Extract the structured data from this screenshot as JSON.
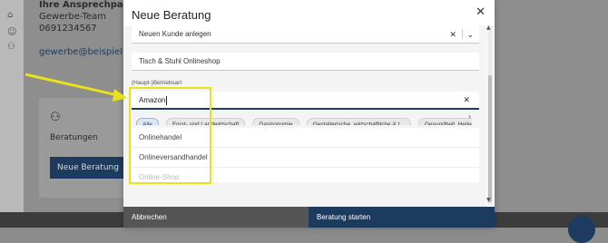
{
  "background": {
    "contact_title": "Ihre Ansprechpartner be",
    "contact_team": "Gewerbe-Team",
    "contact_phone": "0691234567",
    "contact_email": "gewerbe@beispiel.de",
    "card_label": "Beratungen",
    "card_button": "Neue Beratung"
  },
  "modal": {
    "title": "Neue Beratung",
    "customer_field_value": "Neuen Kunde anlegen",
    "shop_field_value": "Tisch & Stuhl Onlineshop",
    "business_type_label": "(Haupt-)Betriebsart",
    "search_value": "Amazon",
    "chips": [
      "Alle",
      "Forst- und Landwirtschaft",
      "Gastronomie",
      "Gestalterische, wirtschaftliche & t...",
      "Gesundheit, Heilwe"
    ],
    "results": [
      "Onlinehandel",
      "Onlineversandhandel",
      "Online-Shop"
    ],
    "cancel_label": "Abbrechen",
    "start_label": "Beratung starten"
  },
  "colors": {
    "primary": "#1d3b5e",
    "annotation": "#e8e21a"
  }
}
